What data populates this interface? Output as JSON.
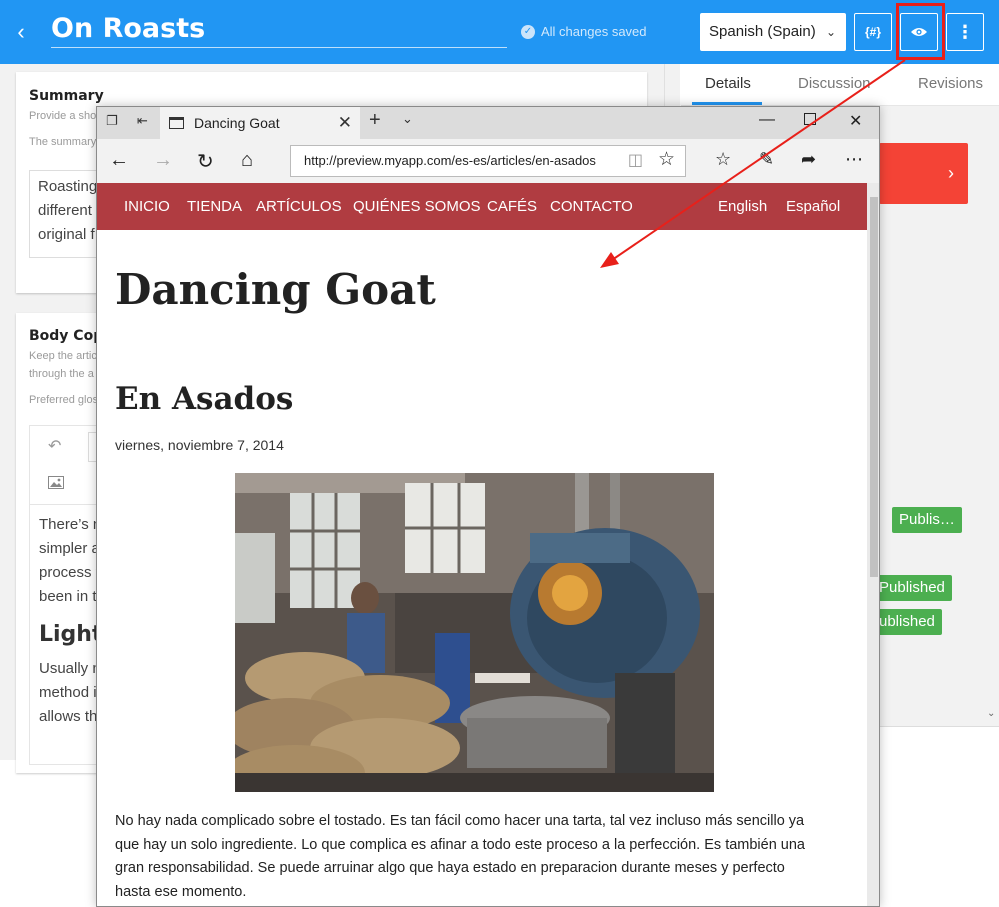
{
  "cms": {
    "title": "On Roasts",
    "saved_status": "All changes saved",
    "language": "Spanish (Spain)",
    "code_button_label": "{#}",
    "tabs": [
      "Details",
      "Discussion",
      "Revisions"
    ],
    "summary": {
      "label": "Summary",
      "hint1": "Provide a sho",
      "hint2": "The summary",
      "text_lines": [
        "Roasting",
        "different",
        "original f"
      ]
    },
    "body_copy": {
      "label": "Body Cop",
      "hint1": "Keep the artic",
      "hint2": "through the a",
      "hint3": "Preferred glos",
      "paragraph1": [
        "There’s n",
        "simpler a",
        "process t",
        "been in t"
      ],
      "heading": "Light",
      "paragraph2": [
        "Usually n",
        "method i",
        "allows th"
      ]
    },
    "workflow_badges": [
      "Publis…",
      "Published",
      "ublished"
    ]
  },
  "browser": {
    "tab_title": "Dancing Goat",
    "url": "http://preview.myapp.com/es-es/articles/en-asados"
  },
  "site": {
    "nav": [
      "INICIO",
      "TIENDA",
      "ARTÍCULOS",
      "QUIÉNES SOMOS",
      "CAFÉS",
      "CONTACTO"
    ],
    "lang_links": [
      "English",
      "Español"
    ],
    "logo": "Dancing Goat",
    "article_title": "En Asados",
    "article_date": "viernes, noviembre 7, 2014",
    "article_body_lines": [
      "No hay nada complicado sobre el tostado. Es tan fácil como hacer una tarta, tal vez incluso más sencillo ya",
      "que hay un solo ingrediente. Lo que complica es afinar a todo este proceso a la perfección. Es también una",
      "gran responsabilidad. Se puede arruinar algo que haya estado en preparacion durante meses y perfecto",
      "hasta ese momento."
    ],
    "photo_alt": "coffee-roaster-photo"
  },
  "colors": {
    "cms_blue": "#2196f3",
    "site_nav_red": "#b03c41",
    "annotation_red": "#e8201a",
    "badge_green": "#4caf50",
    "cta_red": "#f44336"
  }
}
